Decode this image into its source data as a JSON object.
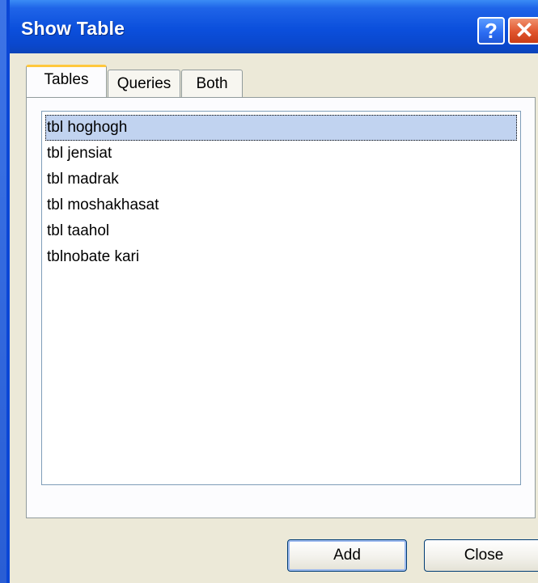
{
  "window": {
    "title": "Show Table",
    "help_label": "?",
    "close_label": "✕"
  },
  "tabs": [
    {
      "label": "Tables",
      "active": true
    },
    {
      "label": "Queries",
      "active": false
    },
    {
      "label": "Both",
      "active": false
    }
  ],
  "table_list": {
    "items": [
      {
        "label": "tbl hoghogh",
        "selected": true
      },
      {
        "label": "tbl jensiat",
        "selected": false
      },
      {
        "label": "tbl madrak",
        "selected": false
      },
      {
        "label": "tbl moshakhasat",
        "selected": false
      },
      {
        "label": "tbl taahol",
        "selected": false
      },
      {
        "label": "tblnobate kari",
        "selected": false
      }
    ]
  },
  "buttons": {
    "add_label": "Add",
    "close_label": "Close"
  },
  "colors": {
    "titlebar": "#0b4fdc",
    "dialog_bg": "#ece9d8",
    "selection": "#c1d3f0",
    "active_tab_accent": "#ffc83c",
    "close_button": "#e0552d"
  }
}
